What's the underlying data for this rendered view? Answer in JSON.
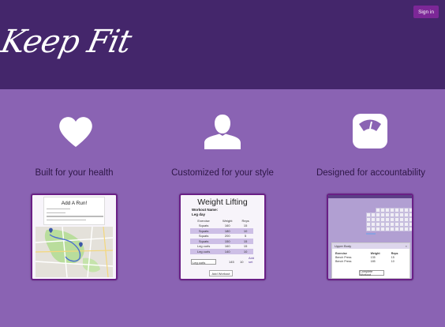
{
  "header": {
    "logo_text": "Keep Fit",
    "signin_label": "Sign in"
  },
  "features": [
    {
      "label": "Built for your health",
      "icon": "heart-icon"
    },
    {
      "label": "Customized for your style",
      "icon": "person-icon"
    },
    {
      "label": "Designed for accountability",
      "icon": "scale-icon"
    }
  ],
  "run_preview": {
    "title": "Add A Run!"
  },
  "weight_preview": {
    "title": "Weight Lifting",
    "workout_name_label": "Workout Name:",
    "day_label": "Leg day",
    "columns": [
      "Exercise",
      "Weight",
      "Reps"
    ],
    "rows": [
      [
        "Squats",
        "160",
        "15"
      ],
      [
        "Squats",
        "180",
        "10"
      ],
      [
        "Squats",
        "200",
        "5"
      ],
      [
        "Squats",
        "150",
        "15"
      ],
      [
        "Leg curls",
        "160",
        "15"
      ],
      [
        "Leg curls",
        "140",
        "10"
      ]
    ],
    "input_exercise": "Leg curls",
    "input_weight": "145",
    "input_reps": "10",
    "add_set_label": "Add set",
    "add_workout_label": "Add Workout"
  },
  "accountability_preview": {
    "panel_title": "Upper Body",
    "columns": [
      "Exercise",
      "Weight",
      "Reps"
    ],
    "rows": [
      [
        "Bench Press",
        "135",
        "15"
      ],
      [
        "Bench Press",
        "185",
        "10"
      ]
    ],
    "complete_label": "Complete Workout"
  },
  "colors": {
    "header_bg": "#44266b",
    "page_bg": "#8a63b3",
    "signin_bg": "#7c2797",
    "icon_white": "#ffffff",
    "frame": "#6a1f86"
  }
}
